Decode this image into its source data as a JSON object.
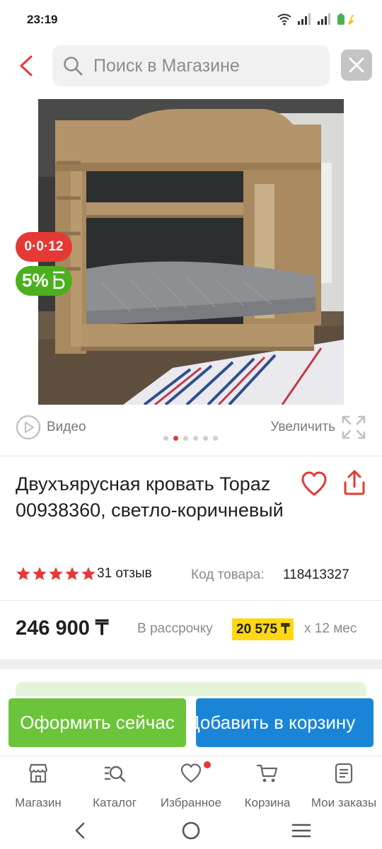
{
  "status": {
    "time": "23:19"
  },
  "search": {
    "placeholder": "Поиск в Магазине"
  },
  "badges": {
    "promo": "0·0·12",
    "bonus_percent": "5%"
  },
  "gallery": {
    "video_label": "Видео",
    "zoom_label": "Увеличить",
    "total_images": 6,
    "active_index": 1
  },
  "product": {
    "title": "Двухъярусная кровать Topaz 00938360, светло-коричневый",
    "rating_stars": 5,
    "reviews": "31 отзыв",
    "sku_label": "Код товара:",
    "sku_value": "118413327",
    "price": "246 900 ₸",
    "installment_label": "В рассрочку",
    "installment_amount": "20 575 ₸",
    "installment_term": "x 12 мес"
  },
  "actions": {
    "checkout": "Оформить сейчас",
    "add_to_cart": "Добавить в корзину"
  },
  "tabbar": {
    "items": [
      {
        "label": "Магазин",
        "icon": "store-icon"
      },
      {
        "label": "Каталог",
        "icon": "catalog-search-icon"
      },
      {
        "label": "Избранное",
        "icon": "heart-icon",
        "has_dot": true
      },
      {
        "label": "Корзина",
        "icon": "cart-icon"
      },
      {
        "label": "Мои заказы",
        "icon": "orders-icon"
      }
    ]
  },
  "colors": {
    "accent_red": "#e53935",
    "green": "#6cc43a",
    "blue": "#1a85d6",
    "installment_highlight": "#ffd814"
  }
}
